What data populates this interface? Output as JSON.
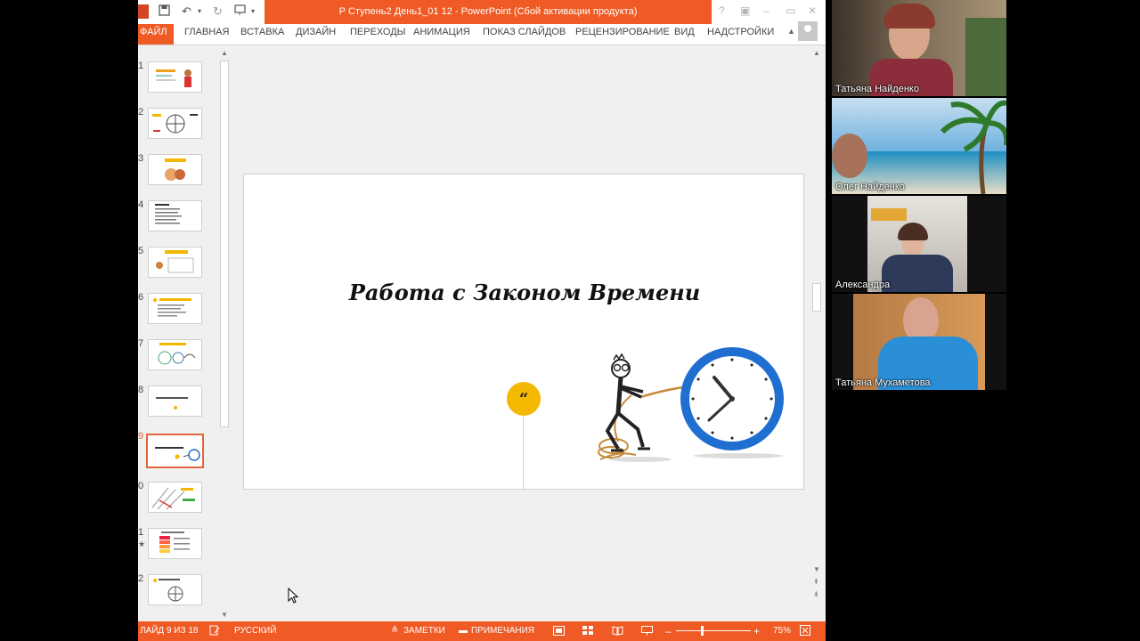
{
  "app": {
    "title": "Р Ступень2  День1_01 12 -  PowerPoint (Сбой активации продукта)",
    "help_icon": "?",
    "window_controls": [
      "–",
      "▭",
      "✕"
    ]
  },
  "ribbon": {
    "tabs": [
      "ФАЙЛ",
      "ГЛАВНАЯ",
      "ВСТАВКА",
      "ДИЗАЙН",
      "ПЕРЕХОДЫ",
      "АНИМАЦИЯ",
      "ПОКАЗ СЛАЙДОВ",
      "РЕЦЕНЗИРОВАНИЕ",
      "ВИД",
      "НАДСТРОЙКИ"
    ]
  },
  "thumbnails": [
    {
      "num": "1"
    },
    {
      "num": "2"
    },
    {
      "num": "3"
    },
    {
      "num": "4"
    },
    {
      "num": "5"
    },
    {
      "num": "6"
    },
    {
      "num": "7"
    },
    {
      "num": "8"
    },
    {
      "num": "9"
    },
    {
      "num": "0"
    },
    {
      "num": "1"
    },
    {
      "num": "2"
    }
  ],
  "selected_thumbnail_index": 8,
  "slide": {
    "title": "Работа с Законом Времени",
    "quote_glyph": "“"
  },
  "statusbar": {
    "slide_info": "ЛАЙД 9 ИЗ 18",
    "language": "РУССКИЙ",
    "notes": "ЗАМЕТКИ",
    "comments": "ПРИМЕЧАНИЯ",
    "zoom": "75%",
    "zoom_minus": "–",
    "zoom_plus": "+"
  },
  "participants": [
    {
      "name": "Татьяна Найденко"
    },
    {
      "name": "Олег Найденко"
    },
    {
      "name": "Александра"
    },
    {
      "name": "Татьяна Мухаметова"
    }
  ],
  "colors": {
    "accent": "#f05a24",
    "quote_circle": "#f4b800",
    "clock_blue": "#1f6fd1"
  }
}
